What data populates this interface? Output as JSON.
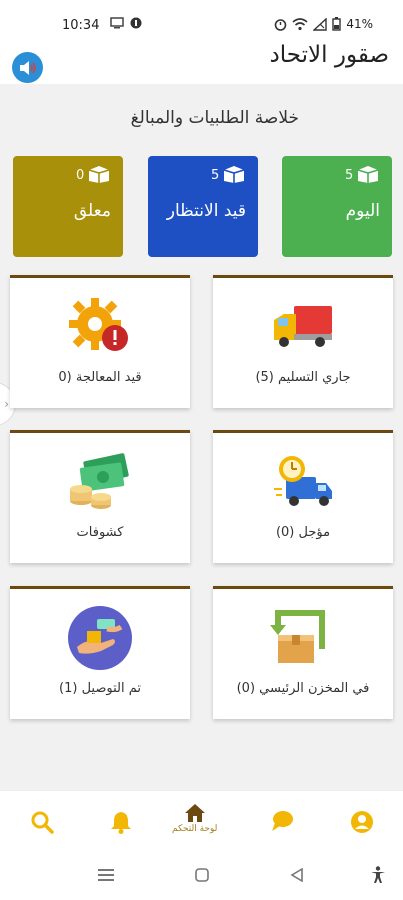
{
  "status_bar": {
    "time": "10:34",
    "battery": "41%"
  },
  "header": {
    "title": "صقور الاتحاد"
  },
  "summary": {
    "title": "خلاصة الطلبيات والمبالغ"
  },
  "stats": [
    {
      "label": "اليوم",
      "count": "5",
      "color": "#4caf50"
    },
    {
      "label": "قيد الانتظار",
      "count": "5",
      "color": "#1e4fc3"
    },
    {
      "label": "معلق",
      "count": "0",
      "color": "#a8900a"
    }
  ],
  "tiles": [
    {
      "label": "جاري التسليم (5)",
      "icon": "truck-icon"
    },
    {
      "label": "قيد المعالجة (0",
      "icon": "gear-alert-icon"
    },
    {
      "label": "مؤجل (0)",
      "icon": "delayed-delivery-icon"
    },
    {
      "label": "كشوفات",
      "icon": "money-icon"
    },
    {
      "label": "في المخزن الرئيسي (0)",
      "icon": "warehouse-return-icon"
    },
    {
      "label": "تم التوصيل (1)",
      "icon": "handover-icon"
    }
  ],
  "bottom_nav": {
    "dashboard_label": "لوحة التحكم"
  },
  "colors": {
    "accent": "#f2b705",
    "tile_border": "#6b4a12",
    "nav_label": "#a08020"
  }
}
